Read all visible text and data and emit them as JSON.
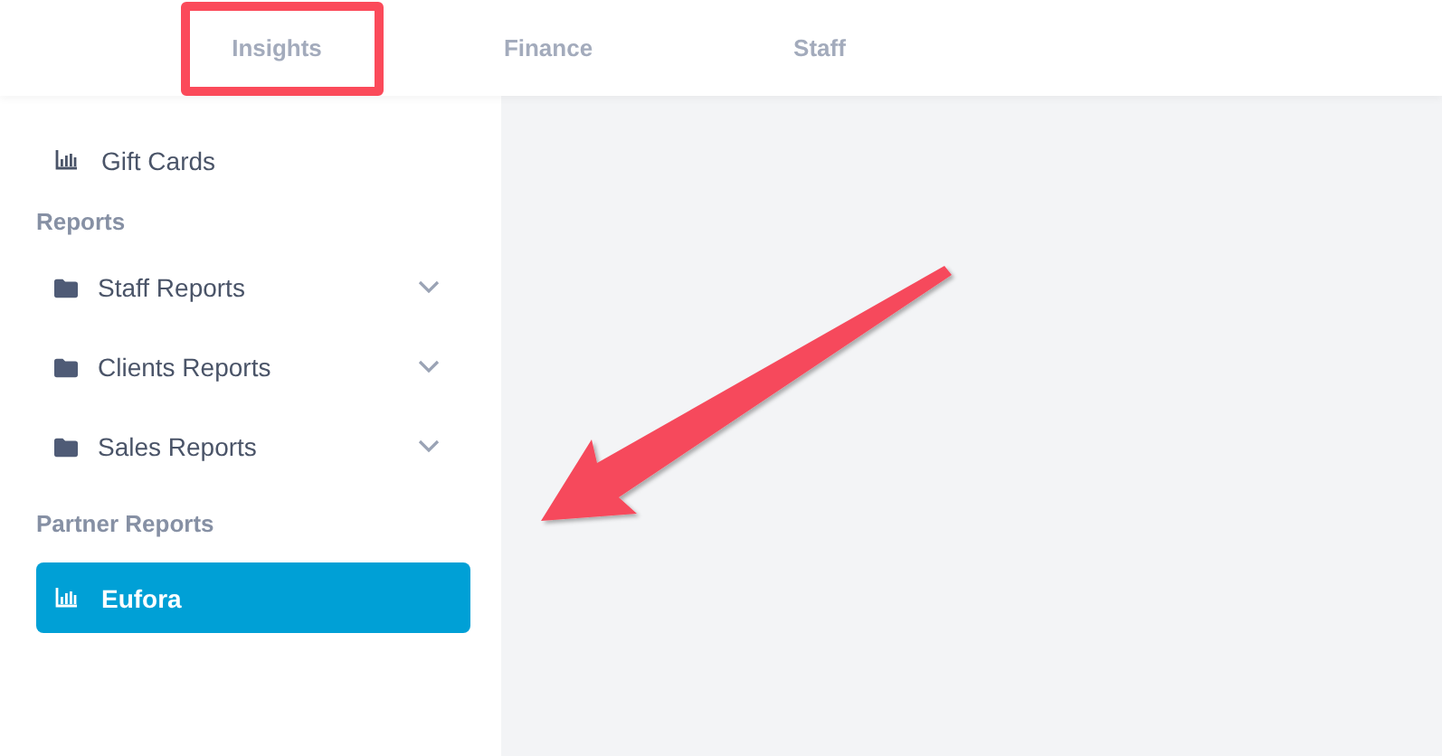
{
  "tabs": [
    {
      "label": "Insights",
      "highlighted": true
    },
    {
      "label": "Finance",
      "highlighted": false
    },
    {
      "label": "Staff",
      "highlighted": false
    }
  ],
  "sidebar": {
    "items": [
      {
        "kind": "link",
        "label": "Gift Cards",
        "selected": false
      },
      {
        "kind": "heading",
        "label": "Reports"
      },
      {
        "kind": "folder",
        "label": "Staff Reports",
        "expanded": false
      },
      {
        "kind": "folder",
        "label": "Clients Reports",
        "expanded": false
      },
      {
        "kind": "folder",
        "label": "Sales Reports",
        "expanded": false
      },
      {
        "kind": "heading",
        "label": "Partner Reports"
      },
      {
        "kind": "link",
        "label": "Eufora",
        "selected": true
      }
    ]
  },
  "annotation_arrow": {
    "shown": true
  }
}
